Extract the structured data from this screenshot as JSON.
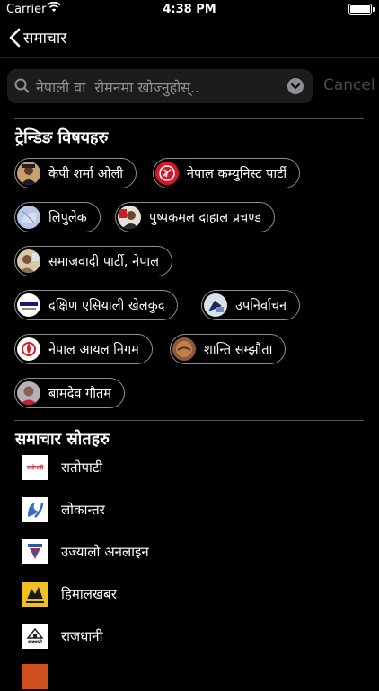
{
  "status": {
    "carrier": "Carrier",
    "time": "4:38 PM"
  },
  "nav": {
    "back_label": "समाचार"
  },
  "search": {
    "placeholder": "नेपाली वा  रोमनमा खोज्नुहोस्..",
    "cancel_label": "Cancel"
  },
  "trending": {
    "title": "ट्रेन्डिङ विषयहरु",
    "topics": [
      {
        "label": "केपी शर्मा ओली",
        "icon": "person-avatar-icon"
      },
      {
        "label": "नेपाल कम्युनिस्ट पार्टी",
        "icon": "party-flag-icon"
      },
      {
        "label": "लिपुलेक",
        "icon": "map-icon"
      },
      {
        "label": "पुष्पकमल दाहाल  प्रचण्ड",
        "icon": "person-avatar-icon"
      },
      {
        "label": "समाजवादी पार्टी, नेपाल",
        "icon": "party-icon"
      },
      {
        "label": "दक्षिण एसियाली खेलकुद",
        "icon": "sports-logo-icon"
      },
      {
        "label": "उपनिर्वाचन",
        "icon": "ballot-icon"
      },
      {
        "label": "नेपाल आयल निगम",
        "icon": "oil-corporation-icon"
      },
      {
        "label": "शान्ति सम्झौता",
        "icon": "handshake-icon"
      },
      {
        "label": "बामदेव गौतम",
        "icon": "person-avatar-icon"
      }
    ]
  },
  "sources": {
    "title": "समाचार स्रोतहरु",
    "items": [
      {
        "name": "रातोपाटी",
        "logo_text": "रातोपाटी"
      },
      {
        "name": "लोकान्तर",
        "logo_text": ""
      },
      {
        "name": "उज्यालो अनलाइन",
        "logo_text": ""
      },
      {
        "name": "हिमालखबर",
        "logo_text": ""
      },
      {
        "name": "राजधानी",
        "logo_text": "राजधानी"
      }
    ]
  },
  "colors": {
    "background": "#000000",
    "chip_border": "#8e8e93",
    "search_bg": "#1c1c1e",
    "cancel": "#4a4a4c"
  }
}
